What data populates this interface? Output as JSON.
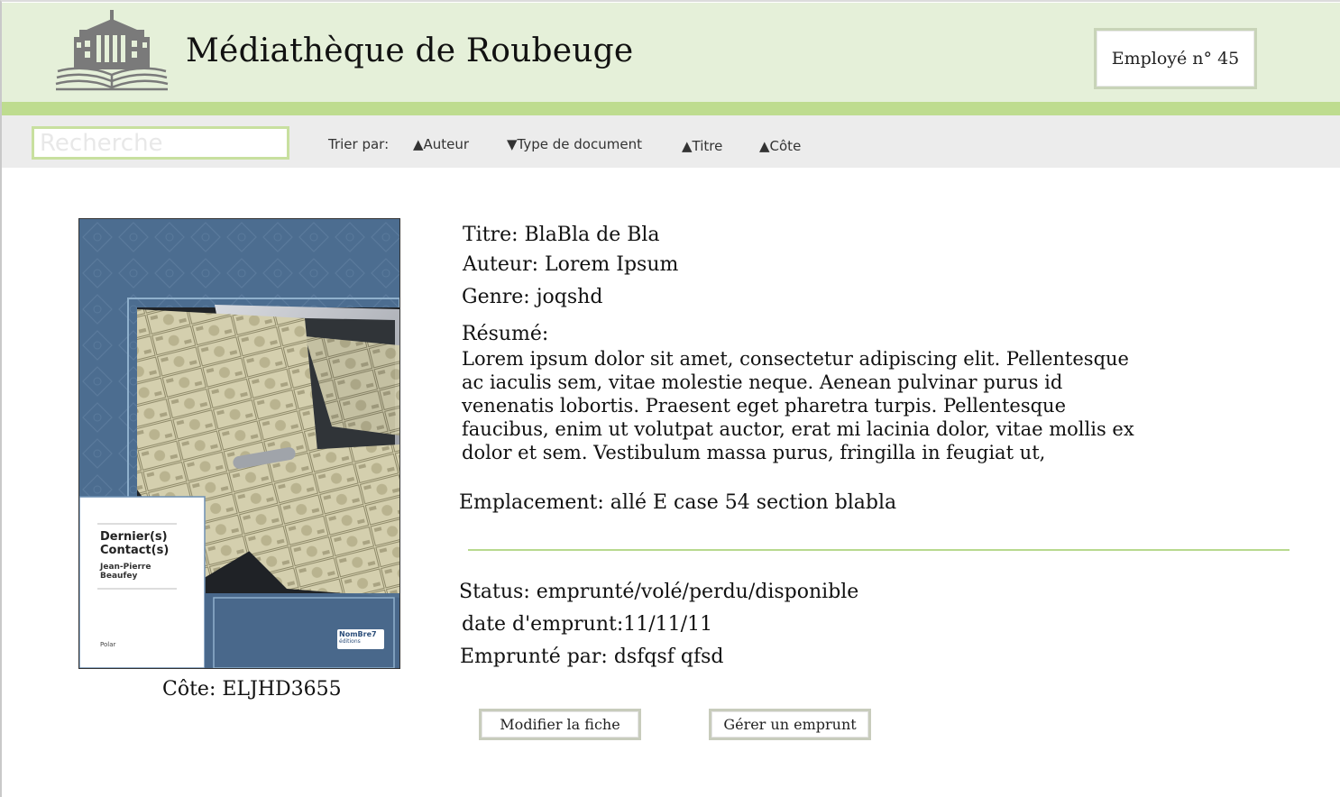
{
  "header": {
    "title": "Médiathèque de Roubeuge",
    "employee": "Employé n° 45",
    "logo_icon": "library-book-building-icon"
  },
  "toolbar": {
    "search_placeholder": "Recherche",
    "sort_label": "Trier par:",
    "sort_options": [
      {
        "label": "▲Auteur"
      },
      {
        "label": "▼Type de document"
      },
      {
        "label": "▲Titre"
      },
      {
        "label": "▲Côte"
      }
    ]
  },
  "book": {
    "cover": {
      "title": "Dernier(s) Contact(s)",
      "title_line1": "Dernier(s)",
      "title_line2": "Contact(s)",
      "author_line1": "Jean-Pierre",
      "author_line2": "Beaufey",
      "collection": "Polar",
      "publisher_line1": "NomBre7",
      "publisher_line2": "éditions"
    },
    "cote": "Côte: ELJHD3655",
    "titre": "Titre: BlaBla de Bla",
    "auteur": "Auteur: Lorem Ipsum",
    "genre": "Genre: joqshd",
    "resume_label": "Résumé:",
    "resume_text": "Lorem ipsum dolor sit amet, consectetur adipiscing elit. Pellentesque ac iaculis sem, vitae molestie neque. Aenean pulvinar purus id venenatis lobortis. Praesent eget pharetra turpis. Pellentesque faucibus, enim ut volutpat auctor, erat mi lacinia dolor, vitae mollis ex dolor et sem. Vestibulum massa purus, fringilla in feugiat ut,",
    "emplacement": "Emplacement: allé E case 54 section blabla",
    "status": "Status: emprunté/volé/perdu/disponible",
    "date_emprunt": "date d'emprunt:11/11/11",
    "emprunte_par": "Emprunté par: dsfqsf qfsd"
  },
  "actions": {
    "modify": "Modifier la fiche",
    "loan": "Gérer un emprunt"
  },
  "colors": {
    "header_bg": "#e5f0d9",
    "accent_green": "#bedc8f",
    "toolbar_bg": "#ececec",
    "cover_blue": "#4c6d90"
  }
}
